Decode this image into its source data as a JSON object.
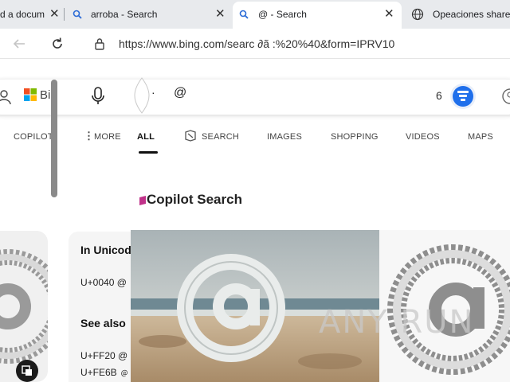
{
  "browser": {
    "tabs": [
      {
        "label": "d a docum"
      },
      {
        "label": "arroba - Search"
      },
      {
        "label": "@ - Search"
      },
      {
        "label": "Opeaciones shared"
      }
    ],
    "url": "https://www.bing.com/searc  ∂ã :%20%40&form=IPRV10"
  },
  "bing": {
    "logo_text": "Bi",
    "query": "@",
    "rewards_count": "6",
    "nav": {
      "copilot": "COPILOT",
      "more": "MORE",
      "all": "ALL",
      "search": "SEARCH",
      "images": "IMAGES",
      "shopping": "SHOPPING",
      "videos": "VIDEOS",
      "maps": "MAPS"
    },
    "copilot_search_title": "Copilot Search",
    "unicode_card": {
      "heading1": "In Unicod",
      "line1": "U+0040 @",
      "heading2": "See also",
      "line2": "U+FF20 @",
      "line3": "U+FE6B ﹫"
    }
  },
  "watermark": "ANY RUN",
  "colors": {
    "accent": "#2b6bd6",
    "tab_strip": "#e8eaed"
  }
}
